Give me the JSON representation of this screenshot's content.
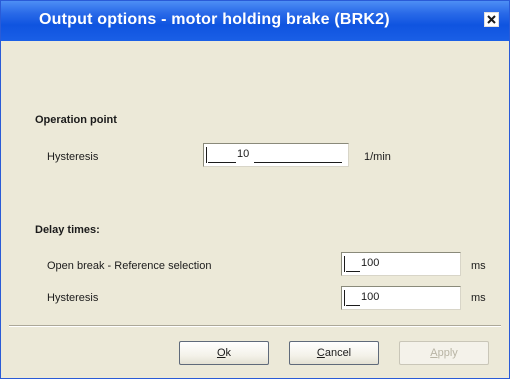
{
  "window": {
    "title": "Output options - motor holding brake (BRK2)"
  },
  "operation_point": {
    "heading": "Operation point",
    "hysteresis": {
      "label": "Hysteresis",
      "value": "10",
      "unit": "1/min"
    }
  },
  "delay_times": {
    "heading": "Delay times:",
    "open_break": {
      "label": "Open break - Reference selection",
      "value": "100",
      "unit": "ms"
    },
    "hysteresis": {
      "label": "Hysteresis",
      "value": "100",
      "unit": "ms"
    }
  },
  "buttons": {
    "ok_mnemonic": "O",
    "ok_rest": "k",
    "cancel_mnemonic": "C",
    "cancel_rest": "ancel",
    "apply_mnemonic": "A",
    "apply_rest": "pply"
  },
  "icons": {
    "close": "close-icon"
  }
}
